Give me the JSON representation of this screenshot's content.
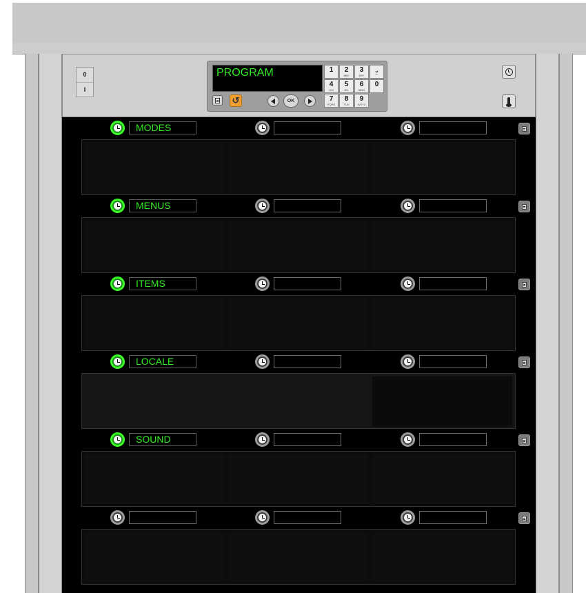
{
  "power_switch": {
    "off_label": "0",
    "on_label": "I"
  },
  "controller": {
    "display_text": "PROGRAM",
    "doc_button_icon": "document-icon",
    "undo_button_icon": "undo-icon",
    "nav": {
      "left_icon": "arrow-left-icon",
      "ok_label": "OK",
      "right_icon": "arrow-right-icon"
    },
    "keypad": [
      {
        "number": "1",
        "letters": ""
      },
      {
        "number": "2",
        "letters": "ABC"
      },
      {
        "number": "3",
        "letters": "DEF"
      },
      {
        "number": "⎵",
        "letters": "+/-"
      },
      {
        "number": "4",
        "letters": "GHI"
      },
      {
        "number": "5",
        "letters": "JKL"
      },
      {
        "number": "6",
        "letters": "MNO"
      },
      {
        "number": "0",
        "letters": ""
      },
      {
        "number": "7",
        "letters": "PQRS"
      },
      {
        "number": "8",
        "letters": "TUV"
      },
      {
        "number": "9",
        "letters": "WXYZ"
      }
    ]
  },
  "side_buttons": {
    "top_icon": "clock-icon",
    "bottom_icon": "thermometer-icon"
  },
  "colors": {
    "active_green": "#33ee22",
    "rack_black": "#000000",
    "chassis_gray": "#c8c8c8",
    "undo_orange": "#f0a030"
  },
  "rows": [
    {
      "zones": [
        {
          "label": "MODES",
          "active": true
        },
        {
          "label": "",
          "active": false
        },
        {
          "label": "",
          "active": false
        }
      ]
    },
    {
      "zones": [
        {
          "label": "MENUS",
          "active": true
        },
        {
          "label": "",
          "active": false
        },
        {
          "label": "",
          "active": false
        }
      ]
    },
    {
      "zones": [
        {
          "label": "ITEMS",
          "active": true
        },
        {
          "label": "",
          "active": false
        },
        {
          "label": "",
          "active": false
        }
      ]
    },
    {
      "zones": [
        {
          "label": "LOCALE",
          "active": true
        },
        {
          "label": "",
          "active": false
        },
        {
          "label": "",
          "active": false
        }
      ]
    },
    {
      "zones": [
        {
          "label": "SOUND",
          "active": true
        },
        {
          "label": "",
          "active": false
        },
        {
          "label": "",
          "active": false
        }
      ]
    },
    {
      "zones": [
        {
          "label": "",
          "active": false
        },
        {
          "label": "",
          "active": false
        },
        {
          "label": "",
          "active": false
        }
      ]
    }
  ]
}
